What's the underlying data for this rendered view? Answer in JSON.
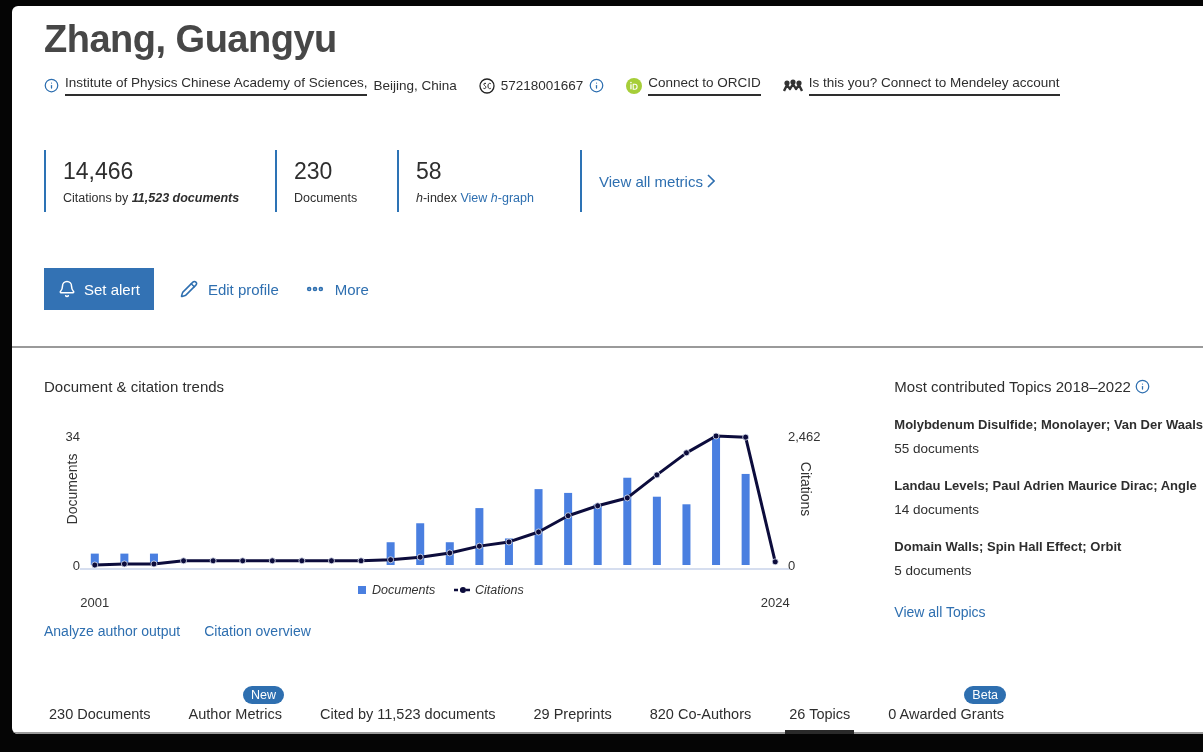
{
  "author": {
    "name": "Zhang, Guangyu"
  },
  "identity": {
    "affiliation_link": "Institute of Physics Chinese Academy of Sciences,",
    "affiliation_location": "Beijing, China",
    "author_id": "57218001667",
    "orcid_link": "Connect to ORCID",
    "mendeley_link": "Is this you? Connect to Mendeley account"
  },
  "metrics": [
    {
      "value": "14,466",
      "label": "Citations by **11,523 documents**"
    },
    {
      "value": "230",
      "label": "Documents"
    },
    {
      "value": "58",
      "label": "*h*-index",
      "link": "View *h*-graph"
    }
  ],
  "view_all_metrics": "View all metrics",
  "actions": [
    {
      "kind": "primary",
      "label": "Set alert"
    },
    {
      "kind": "edit",
      "label": "Edit profile"
    },
    {
      "kind": "more",
      "label": "More"
    }
  ],
  "trends": {
    "title": "Document & citation trends",
    "documents": {
      "chart_data": {
        "type": "bar",
        "x": [
          2001,
          2002,
          2003,
          2004,
          2005,
          2006,
          2007,
          2008,
          2009,
          2010,
          2011,
          2012,
          2013,
          2014,
          2015,
          2016,
          2017,
          2018,
          2019,
          2020,
          2021,
          2022,
          2023,
          2024
        ],
        "xlim": [
          2000.5,
          2024.5
        ],
        "xticks": [
          2001,
          2024
        ],
        "ylabel": "Documents",
        "ylim": [
          0,
          34
        ],
        "yticks": [
          0,
          34
        ],
        "series": [
          {
            "name": "Documents",
            "color": "#4a7fe0",
            "values": [
              3,
              3,
              3,
              0,
              0,
              0,
              0,
              0,
              0,
              0,
              6,
              11,
              6,
              15,
              7,
              20,
              19,
              16,
              23,
              18,
              16,
              34,
              24,
              0
            ]
          }
        ]
      }
    },
    "citations": {
      "chart_data": {
        "type": "line",
        "ylabel": "Citations",
        "ylim": [
          0,
          2462
        ],
        "yticks": [
          0,
          {
            "value": 2462,
            "label": "2,462"
          }
        ],
        "series": [
          {
            "name": "Citations",
            "color": "#0c0c3c",
            "marker": true,
            "values": [
              0,
              20,
              20,
              80,
              80,
              80,
              80,
              80,
              80,
              80,
              100,
              150,
              230,
              360,
              440,
              630,
              940,
              1130,
              1280,
              1720,
              2140,
              2462,
              2440,
              60
            ]
          }
        ]
      }
    },
    "links": [
      "Analyze author output",
      "Citation overview"
    ]
  },
  "topics": {
    "title": "Most contributed Topics 2018–2022",
    "items": [
      {
        "name": "Molybdenum Disulfide; Monolayer; Van Der Waals",
        "count": "55 documents"
      },
      {
        "name": "Landau Levels; Paul Adrien Maurice Dirac; Angle",
        "count": "14 documents"
      },
      {
        "name": "Domain Walls; Spin Hall Effect; Orbit",
        "count": "5 documents"
      }
    ],
    "view_all": "View all Topics"
  },
  "tabs": [
    {
      "label": "230 Documents",
      "selected": false
    },
    {
      "label": "Author Metrics",
      "selected": false,
      "badge": "New"
    },
    {
      "label": "Cited by 11,523 documents",
      "selected": false
    },
    {
      "label": "29 Preprints",
      "selected": false
    },
    {
      "label": "820 Co-Authors",
      "selected": false
    },
    {
      "label": "26 Topics",
      "selected": true
    },
    {
      "label": "0 Awarded Grants",
      "selected": false,
      "badge": "Beta"
    }
  ]
}
